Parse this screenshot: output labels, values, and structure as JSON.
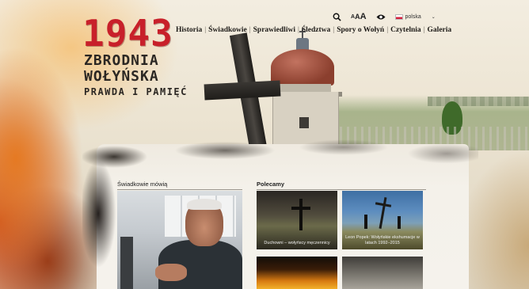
{
  "logo": {
    "year": "1943",
    "line1": "ZBRODNIA",
    "line2": "WOŁYŃSKA",
    "line3": "PRAWDA I PAMIĘĆ"
  },
  "tools": {
    "font_small": "A",
    "font_medium": "A",
    "font_large": "A",
    "language": "polska"
  },
  "nav": {
    "items": [
      "Historia",
      "Świadkowie",
      "Sprawiedliwi",
      "Śledztwa",
      "Spory o Wołyń",
      "Czytelnia",
      "Galeria"
    ],
    "separator": "|"
  },
  "sections": {
    "witnesses_title": "Świadkowie mówią",
    "recommended_title": "Polecamy"
  },
  "recommended": [
    {
      "caption": "Duchowni – wołyńscy męczennicy"
    },
    {
      "caption": "Leon Popek: Wołyńskie ekshumacje w latach 1992–2015"
    }
  ],
  "colors": {
    "logo_red": "#c8202a",
    "nav_text": "#1e1b18"
  }
}
